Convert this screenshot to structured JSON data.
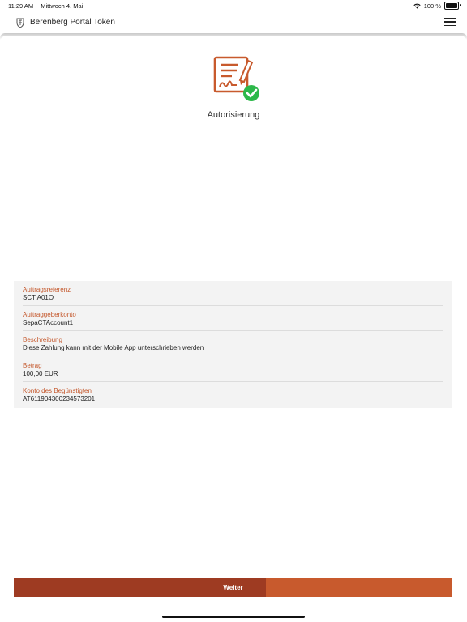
{
  "status_bar": {
    "time": "11:29 AM",
    "date": "Mittwoch 4. Mai",
    "battery": "100 %",
    "battery_level": 1.0
  },
  "nav": {
    "title": "Berenberg Portal Token",
    "logo_icon": "berenberg-crest-icon",
    "menu_icon": "hamburger-menu-icon"
  },
  "hero": {
    "icon": "signed-document-check-icon",
    "title": "Autorisierung"
  },
  "details": [
    {
      "label": "Auftragsreferenz",
      "value": "SCT A01O"
    },
    {
      "label": "Auftraggeberkonto",
      "value": "SepaCTAccount1"
    },
    {
      "label": "Beschreibung",
      "value": "Diese Zahlung kann mit der Mobile App unterschrieben werden"
    },
    {
      "label": "Betrag",
      "value": "100,00 EUR"
    },
    {
      "label": "Konto des Begünstigten",
      "value": "AT611904300234573201"
    }
  ],
  "action": {
    "label": "Weiter",
    "progress": 0.575
  },
  "colors": {
    "accent": "#c85a2d",
    "accent_dark": "#9e3b22",
    "check_green": "#2db84a",
    "card_bg": "#f3f3f3"
  }
}
